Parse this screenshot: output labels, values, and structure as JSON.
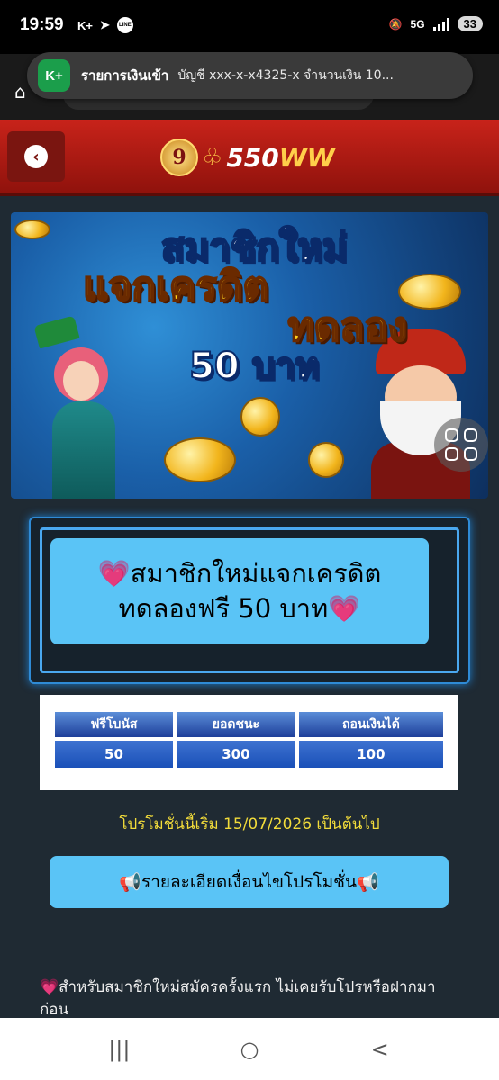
{
  "status_bar": {
    "time": "19:59",
    "left_icons": [
      "k-plus-icon",
      "telegram-icon",
      "line-icon"
    ],
    "k_plus": "K+",
    "line": "LINE",
    "net": "5G",
    "battery": "33"
  },
  "notification": {
    "app_icon_label": "K+",
    "title": "รายการเงินเข้า",
    "body": "บัญชี xxx-x-x4325-x  จำนวนเงิน 10..."
  },
  "header": {
    "logo_number": "9",
    "logo_prefix": "550",
    "logo_suffix": "WW"
  },
  "banner": {
    "line1": "สมาชิกใหม่",
    "line2": "แจกเครดิต",
    "line3": "ทดลอง",
    "line4": "50 บาท"
  },
  "promo": {
    "heading": "💗สมาชิกใหม่แจกเครดิตทดลองฟรี 50 บาท💗",
    "table": {
      "headers": [
        "ฟรีโบนัส",
        "ยอดชนะ",
        "ถอนเงินได้"
      ],
      "values": [
        "50",
        "300",
        "100"
      ]
    },
    "start_note": "โปรโมชั่นนี้เริ่ม 15/07/2026 เป็นต้นไป",
    "details_button": "รายละเอียดเงื่อนไขโปรโมชั่น",
    "terms_text": "สำหรับสมาชิกใหม่สมัครครั้งแรก ไม่เคยรับโปรหรือฝากมาก่อน"
  },
  "nav": {
    "recent": "|||",
    "home": "○",
    "back": "<"
  },
  "colors": {
    "header_red": "#c8231a",
    "accent_blue": "#5ac4f6",
    "table_blue": "#1e3f9a",
    "date_yellow": "#f2dc3a"
  }
}
